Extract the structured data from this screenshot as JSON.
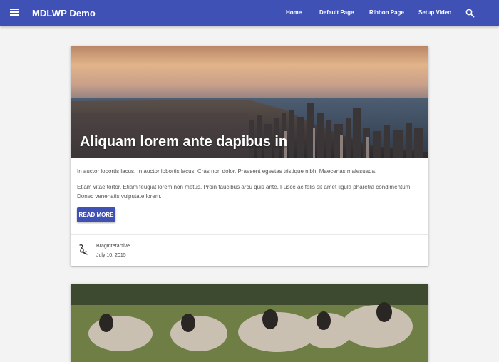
{
  "appbar": {
    "title": "MDLWP Demo",
    "color": "#3f51b5",
    "menu_icon": "hamburger-menu-icon",
    "search_icon": "search-icon",
    "nav": [
      {
        "label": "Home"
      },
      {
        "label": "Default Page"
      },
      {
        "label": "Ribbon Page"
      },
      {
        "label": "Setup Video"
      }
    ]
  },
  "posts": [
    {
      "title": "Aliquam lorem ante dapibus in",
      "image": "city-skyline-photo",
      "paragraphs": [
        "In auctor lobortis lacus. In auctor lobortis lacus. Cras non dolor. Praesent egestas tristique nibh. Maecenas malesuada.",
        "Etiam vitae tortor. Etiam feugiat lorem non metus. Proin faucibus arcu quis ante. Fusce ac felis sit amet ligula pharetra condimentum. Donec venenatis vulputate lorem."
      ],
      "button_label": "READ MORE",
      "author": "BragInteractive",
      "date": "July 10, 2015"
    },
    {
      "image": "sheep-flock-photo"
    }
  ]
}
